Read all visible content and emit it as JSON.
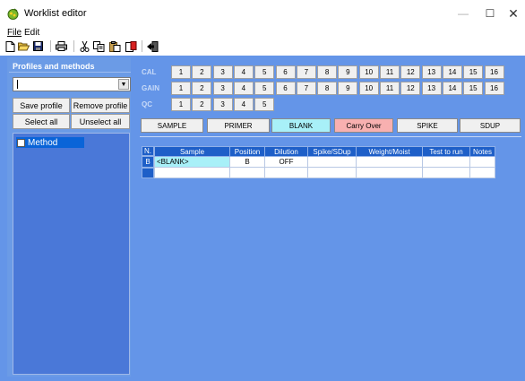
{
  "window": {
    "title": "Worklist editor"
  },
  "menu": {
    "file": "File",
    "edit": "Edit"
  },
  "toolbar": {
    "icons": [
      "new-icon",
      "open-icon",
      "save-icon",
      "print-icon",
      "cut-icon",
      "copy-icon",
      "paste-icon",
      "delete-icon",
      "exit-icon"
    ]
  },
  "left": {
    "title": "Profiles and methods",
    "save_profile": "Save profile",
    "remove_profile": "Remove profile",
    "select_all": "Select all",
    "unselect_all": "Unselect all",
    "method_item": "Method"
  },
  "rows": {
    "cal_label": "CAL",
    "gain_label": "GAIN",
    "qc_label": "QC",
    "cal": [
      "1",
      "2",
      "3",
      "4",
      "5",
      "6",
      "7",
      "8",
      "9",
      "10",
      "11",
      "12",
      "13",
      "14",
      "15",
      "16"
    ],
    "gain": [
      "1",
      "2",
      "3",
      "4",
      "5",
      "6",
      "7",
      "8",
      "9",
      "10",
      "11",
      "12",
      "13",
      "14",
      "15",
      "16"
    ],
    "qc": [
      "1",
      "2",
      "3",
      "4",
      "5"
    ]
  },
  "types": {
    "sample": "SAMPLE",
    "primer": "PRIMER",
    "blank": "BLANK",
    "carry_over": "Carry Over",
    "spike": "SPIKE",
    "sdup": "SDUP"
  },
  "grid": {
    "n_header": "N.",
    "headers": [
      "Sample",
      "Position",
      "Dilution",
      "Spike/SDup",
      "Weight/Moist",
      "Test to run",
      "Notes"
    ],
    "row1": {
      "n": "B",
      "sample": "<BLANK>",
      "position": "B",
      "dilution": "OFF",
      "spike": "",
      "weight": "",
      "test": "",
      "notes": ""
    }
  },
  "colors": {
    "background": "#6495e8",
    "selected": "#0a64d8",
    "blank_btn": "#a8f0f8",
    "carry_over_btn": "#f8b0b0",
    "cell_highlight": "#a8f0f8"
  }
}
